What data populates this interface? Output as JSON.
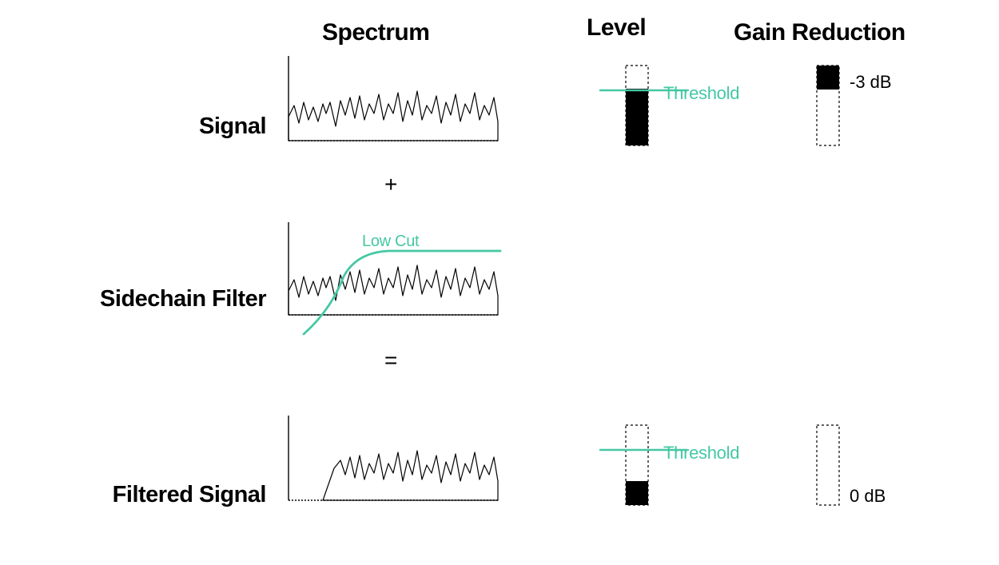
{
  "headers": {
    "spectrum": "Spectrum",
    "level": "Level",
    "gain_reduction": "Gain Reduction"
  },
  "rows": {
    "signal": "Signal",
    "sidechain": "Sidechain Filter",
    "filtered": "Filtered Signal"
  },
  "operators": {
    "plus": "+",
    "equals": "="
  },
  "labels": {
    "threshold1": "Threshold",
    "threshold2": "Threshold",
    "lowcut": "Low Cut",
    "gr1": "-3 dB",
    "gr2": "0 dB"
  },
  "colors": {
    "accent": "#45c8a4",
    "stroke": "#000000"
  },
  "chart_data": {
    "type": "diagram",
    "description": "Sidechain filter concept: a full-band signal crosses the compressor threshold (≈-3 dB gain reduction). Applying a low-cut sidechain filter removes low frequencies from the detector so the filtered signal's level stays below threshold (0 dB gain reduction).",
    "threshold_fraction_from_top": 0.35,
    "rows": [
      {
        "name": "Signal",
        "spectrum": "broadband_noise_full",
        "level_fill_fraction": 0.71,
        "gain_reduction_db": -3
      },
      {
        "name": "Sidechain Filter",
        "spectrum": "broadband_noise_full",
        "overlay_curve": "high_pass_low_cut",
        "level_fill_fraction": null,
        "gain_reduction_db": null
      },
      {
        "name": "Filtered Signal",
        "spectrum": "broadband_noise_lows_removed",
        "level_fill_fraction": 0.3,
        "gain_reduction_db": 0
      }
    ]
  }
}
